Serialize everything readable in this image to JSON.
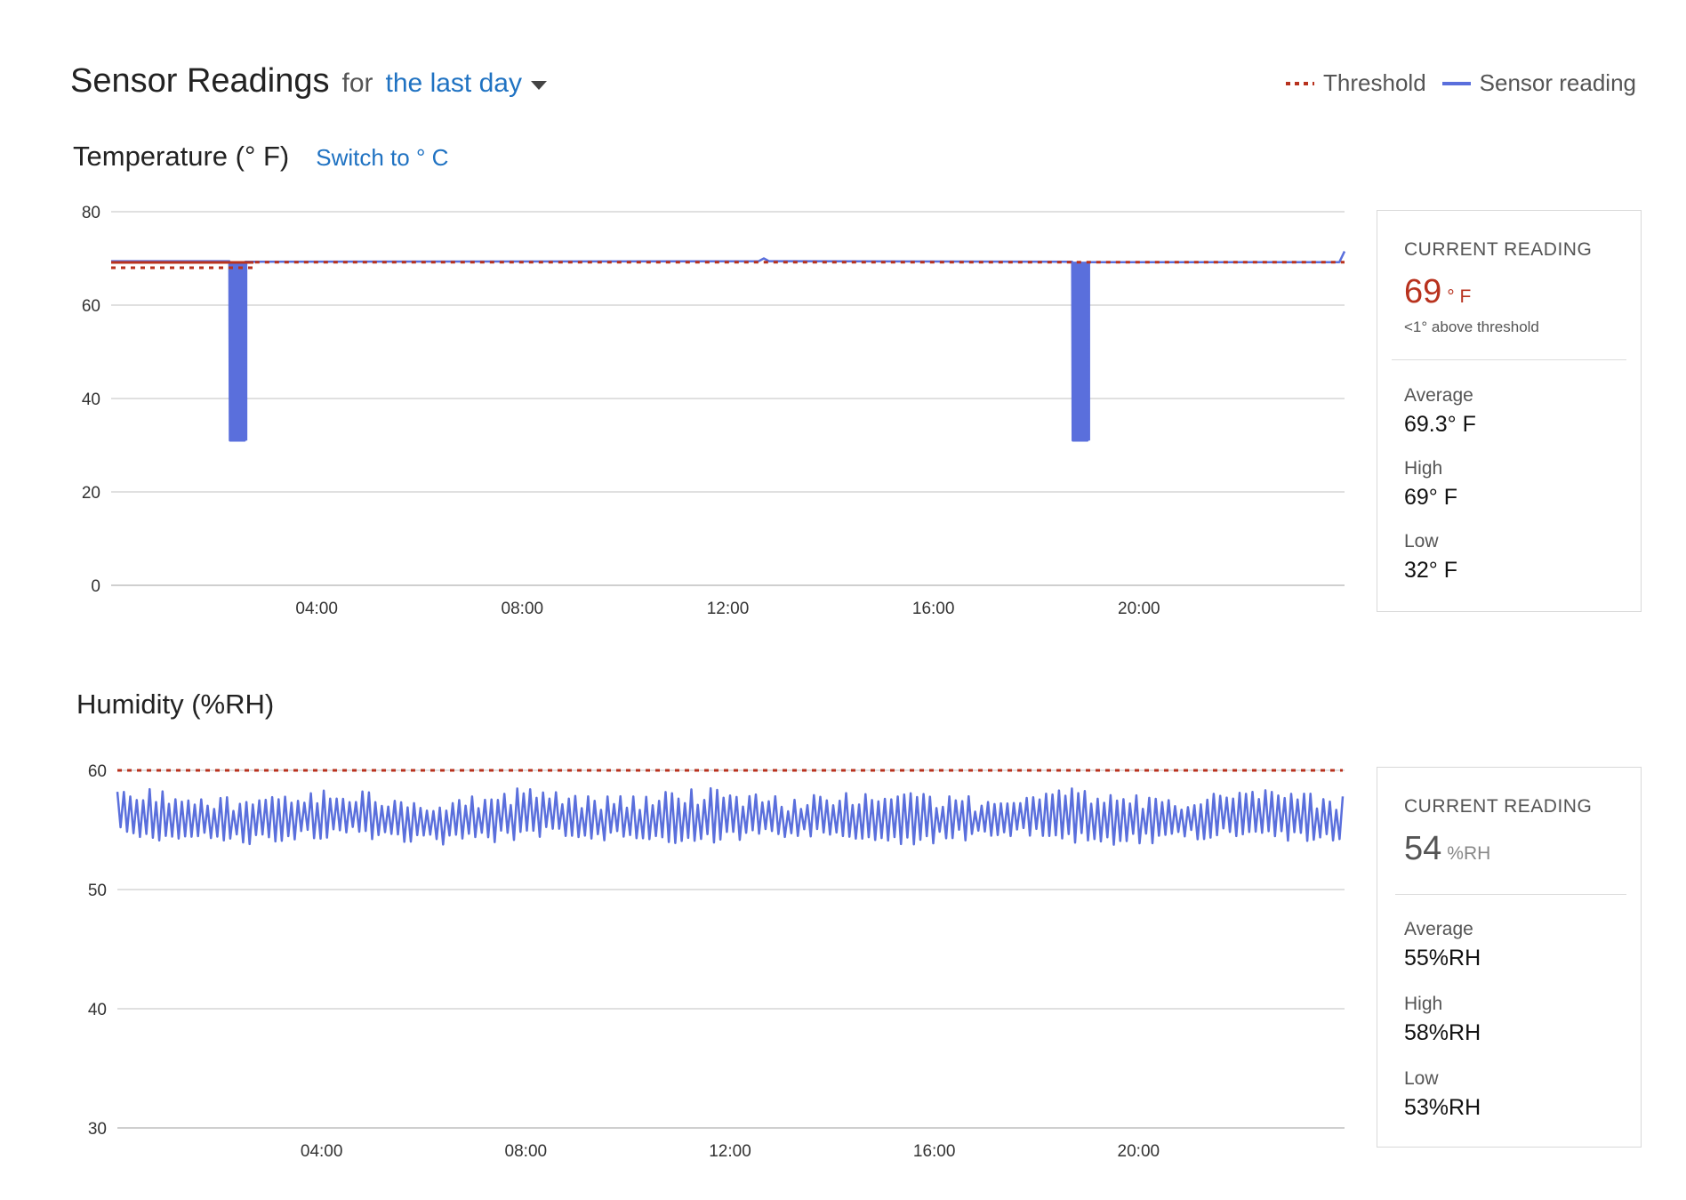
{
  "header": {
    "title": "Sensor Readings",
    "for_text": "for",
    "range_label": "the last day",
    "legend": {
      "threshold": "Threshold",
      "sensor": "Sensor reading"
    }
  },
  "colors": {
    "threshold": "#b8321e",
    "sensor": "#5a6fdc",
    "link": "#1f72c2",
    "grid": "#e0e0e0"
  },
  "temperature": {
    "title": "Temperature (° F)",
    "switch_label": "Switch to ° C",
    "card": {
      "current_heading": "CURRENT READING",
      "current_value": "69",
      "current_unit": "° F",
      "note": "<1° above threshold",
      "average_label": "Average",
      "average_value": "69.3° F",
      "high_label": "High",
      "high_value": "69° F",
      "low_label": "Low",
      "low_value": "32° F"
    }
  },
  "humidity": {
    "title": "Humidity (%RH)",
    "card": {
      "current_heading": "CURRENT READING",
      "current_value": "54",
      "current_unit": "%RH",
      "average_label": "Average",
      "average_value": "55%RH",
      "high_label": "High",
      "high_value": "58%RH",
      "low_label": "Low",
      "low_value": "53%RH"
    }
  },
  "chart_data": [
    {
      "type": "line",
      "ylim": [
        0,
        80
      ],
      "y_ticks": [
        "80",
        "60",
        "40",
        "20",
        "0"
      ],
      "x_range_hours": [
        0,
        24
      ],
      "x_ticks": [
        {
          "hour": 4,
          "label": "04:00"
        },
        {
          "hour": 8,
          "label": "08:00"
        },
        {
          "hour": 12,
          "label": "12:00"
        },
        {
          "hour": 16,
          "label": "16:00"
        },
        {
          "hour": 20,
          "label": "20:00"
        }
      ],
      "series": [
        {
          "role": "sensor",
          "x": [
            0,
            2.3,
            2.31,
            2.6,
            2.61,
            12.6,
            12.7,
            12.8,
            18.7,
            18.71,
            19.0,
            19.01,
            23.9,
            24
          ],
          "values": [
            69.4,
            69.4,
            31,
            31,
            69.3,
            69.4,
            70,
            69.4,
            69.3,
            31,
            31,
            69.2,
            69.2,
            71.5
          ]
        },
        {
          "role": "threshold",
          "x": [
            0,
            2.8
          ],
          "values": [
            68,
            68
          ]
        },
        {
          "role": "threshold",
          "x": [
            2.8,
            24
          ],
          "values": [
            69.2,
            69.2
          ]
        }
      ],
      "bar_spikes": [
        {
          "x_start": 2.3,
          "x_end": 2.65,
          "value": 31
        },
        {
          "x_start": 18.7,
          "x_end": 19.05,
          "value": 31
        }
      ]
    },
    {
      "type": "line",
      "ylim": [
        30,
        60
      ],
      "y_ticks": [
        "60",
        "50",
        "40",
        "30"
      ],
      "x_range_hours": [
        0,
        24
      ],
      "x_ticks": [
        {
          "hour": 4,
          "label": "04:00"
        },
        {
          "hour": 8,
          "label": "08:00"
        },
        {
          "hour": 12,
          "label": "12:00"
        },
        {
          "hour": 16,
          "label": "16:00"
        },
        {
          "hour": 20,
          "label": "20:00"
        }
      ],
      "series": [
        {
          "role": "threshold",
          "x": [
            0,
            24
          ],
          "values": [
            60,
            60
          ]
        },
        {
          "role": "sensor",
          "pattern": "oscillating",
          "cycles": 190,
          "low": 53.2,
          "high": 58.2
        }
      ]
    }
  ]
}
